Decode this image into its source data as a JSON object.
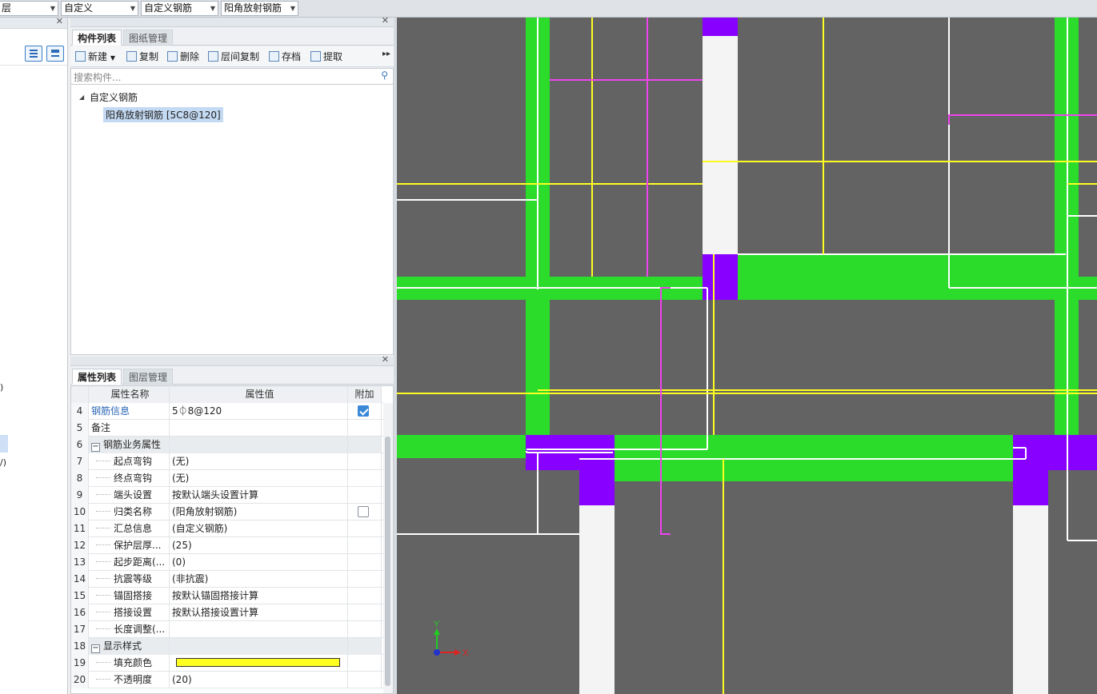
{
  "toolbar_combos": {
    "floor": "层",
    "category": "自定义",
    "type": "自定义钢筋",
    "component": "阳角放射钢筋"
  },
  "left_fragments": {
    "paren1": ")",
    "paren2": "/)"
  },
  "component_panel": {
    "tabs": [
      "构件列表",
      "图纸管理"
    ],
    "toolbar": {
      "new": "新建",
      "copy": "复制",
      "delete": "删除",
      "floor_copy": "层间复制",
      "save": "存档",
      "extract": "提取"
    },
    "search_placeholder": "搜索构件...",
    "tree": {
      "root": "自定义钢筋",
      "child": "阳角放射钢筋 [5C8@120]"
    }
  },
  "property_panel": {
    "tabs": [
      "属性列表",
      "图层管理"
    ],
    "headers": {
      "name": "属性名称",
      "value": "属性值",
      "extra": "附加"
    },
    "rows": [
      {
        "num": "4",
        "name": "钢筋信息",
        "value": "5⏀8@120",
        "checkbox": "checked"
      },
      {
        "num": "5",
        "name": "备注",
        "value": ""
      },
      {
        "num": "6",
        "name": "钢筋业务属性",
        "value": "",
        "group": true
      },
      {
        "num": "7",
        "name": "起点弯钩",
        "value": "(无)"
      },
      {
        "num": "8",
        "name": "终点弯钩",
        "value": "(无)"
      },
      {
        "num": "9",
        "name": "端头设置",
        "value": "按默认端头设置计算"
      },
      {
        "num": "10",
        "name": "归类名称",
        "value": "(阳角放射钢筋)",
        "checkbox": "unchecked"
      },
      {
        "num": "11",
        "name": "汇总信息",
        "value": "(自定义钢筋)"
      },
      {
        "num": "12",
        "name": "保护层厚...",
        "value": "(25)"
      },
      {
        "num": "13",
        "name": "起步距离(...",
        "value": "(0)"
      },
      {
        "num": "14",
        "name": "抗震等级",
        "value": "(非抗震)"
      },
      {
        "num": "15",
        "name": "锚固搭接",
        "value": "按默认锚固搭接计算"
      },
      {
        "num": "16",
        "name": "搭接设置",
        "value": "按默认搭接设置计算"
      },
      {
        "num": "17",
        "name": "长度调整(...",
        "value": ""
      },
      {
        "num": "18",
        "name": "显示样式",
        "value": "",
        "group": true
      },
      {
        "num": "19",
        "name": "填充颜色",
        "value": "",
        "swatch": "#ffff22"
      },
      {
        "num": "20",
        "name": "不透明度",
        "value": "(20)"
      }
    ]
  },
  "canvas": {
    "axis_y": "Y",
    "axis_x": "X",
    "colors": {
      "background": "#636363",
      "wall": "#2bdc2b",
      "column": "#8800ff",
      "opening": "#f4f4f4",
      "rebar_yellow": "#ffff22",
      "rebar_magenta": "#ee44ee",
      "outline": "#ffffff"
    }
  }
}
